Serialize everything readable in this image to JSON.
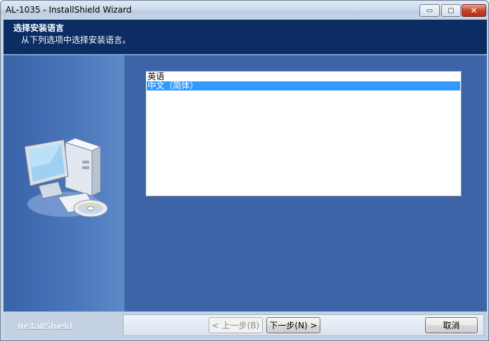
{
  "window": {
    "title": "AL-1035 - InstallShield Wizard",
    "controls": {
      "minimize": "▭",
      "maximize": "▢",
      "close": "✕"
    }
  },
  "header": {
    "title": "选择安装语言",
    "subtitle": "从下列选项中选择安装语言。"
  },
  "language_list": {
    "items": [
      {
        "label": "英语",
        "selected": false
      },
      {
        "label": "中文（简体）",
        "selected": true
      }
    ]
  },
  "footer": {
    "brand": "InstallShield",
    "back_label": "< 上一步(B)",
    "next_label": "下一步(N) >",
    "cancel_label": "取消"
  },
  "colors": {
    "header_bg": "#0b2d63",
    "body_bg": "#3c64a6",
    "selection": "#3399ff"
  },
  "icons": {
    "illustration": "computer-with-cd-icon"
  }
}
